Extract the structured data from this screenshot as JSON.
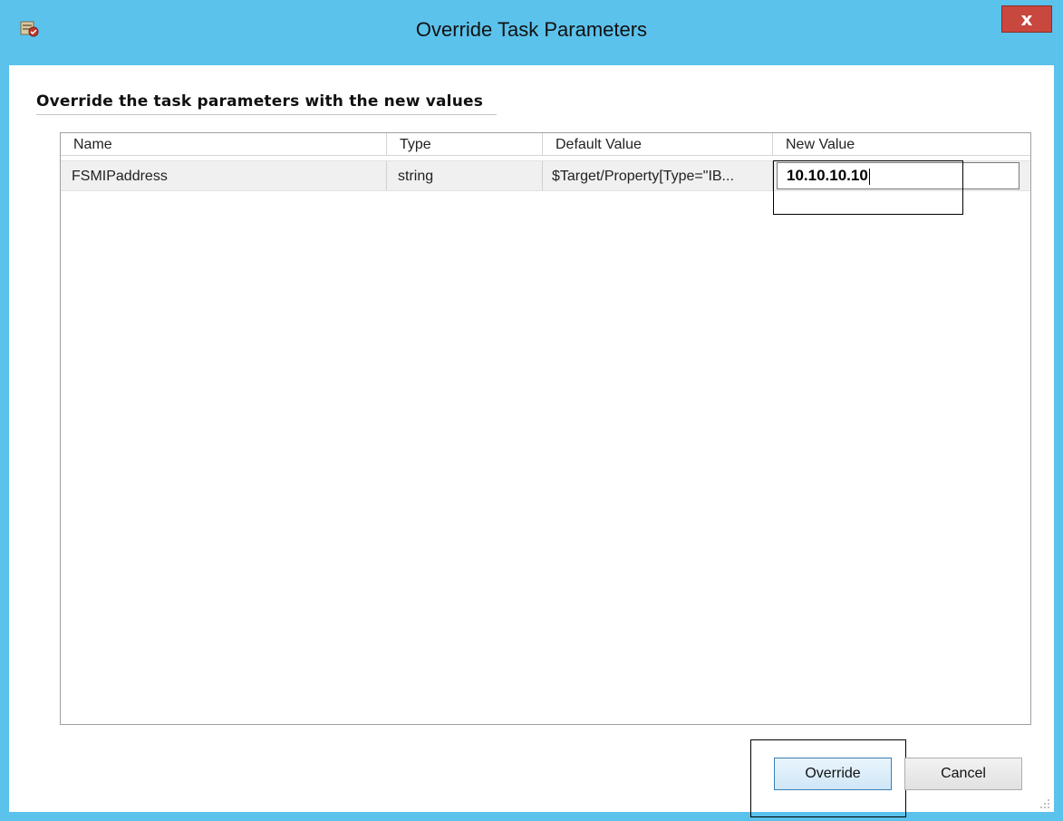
{
  "window": {
    "title": "Override Task Parameters",
    "icon": "task-app-icon",
    "close_label": "x",
    "accent_color": "#5bc2ec",
    "close_color": "#c8473f"
  },
  "section": {
    "heading": "Override the task parameters with the new values"
  },
  "grid": {
    "columns": [
      "Name",
      "Type",
      "Default Value",
      "New Value"
    ],
    "rows": [
      {
        "name": "FSMIPaddress",
        "type": "string",
        "default_value": "$Target/Property[Type=\"IB...",
        "new_value": "10.10.10.10"
      }
    ]
  },
  "buttons": {
    "override": "Override",
    "cancel": "Cancel"
  }
}
